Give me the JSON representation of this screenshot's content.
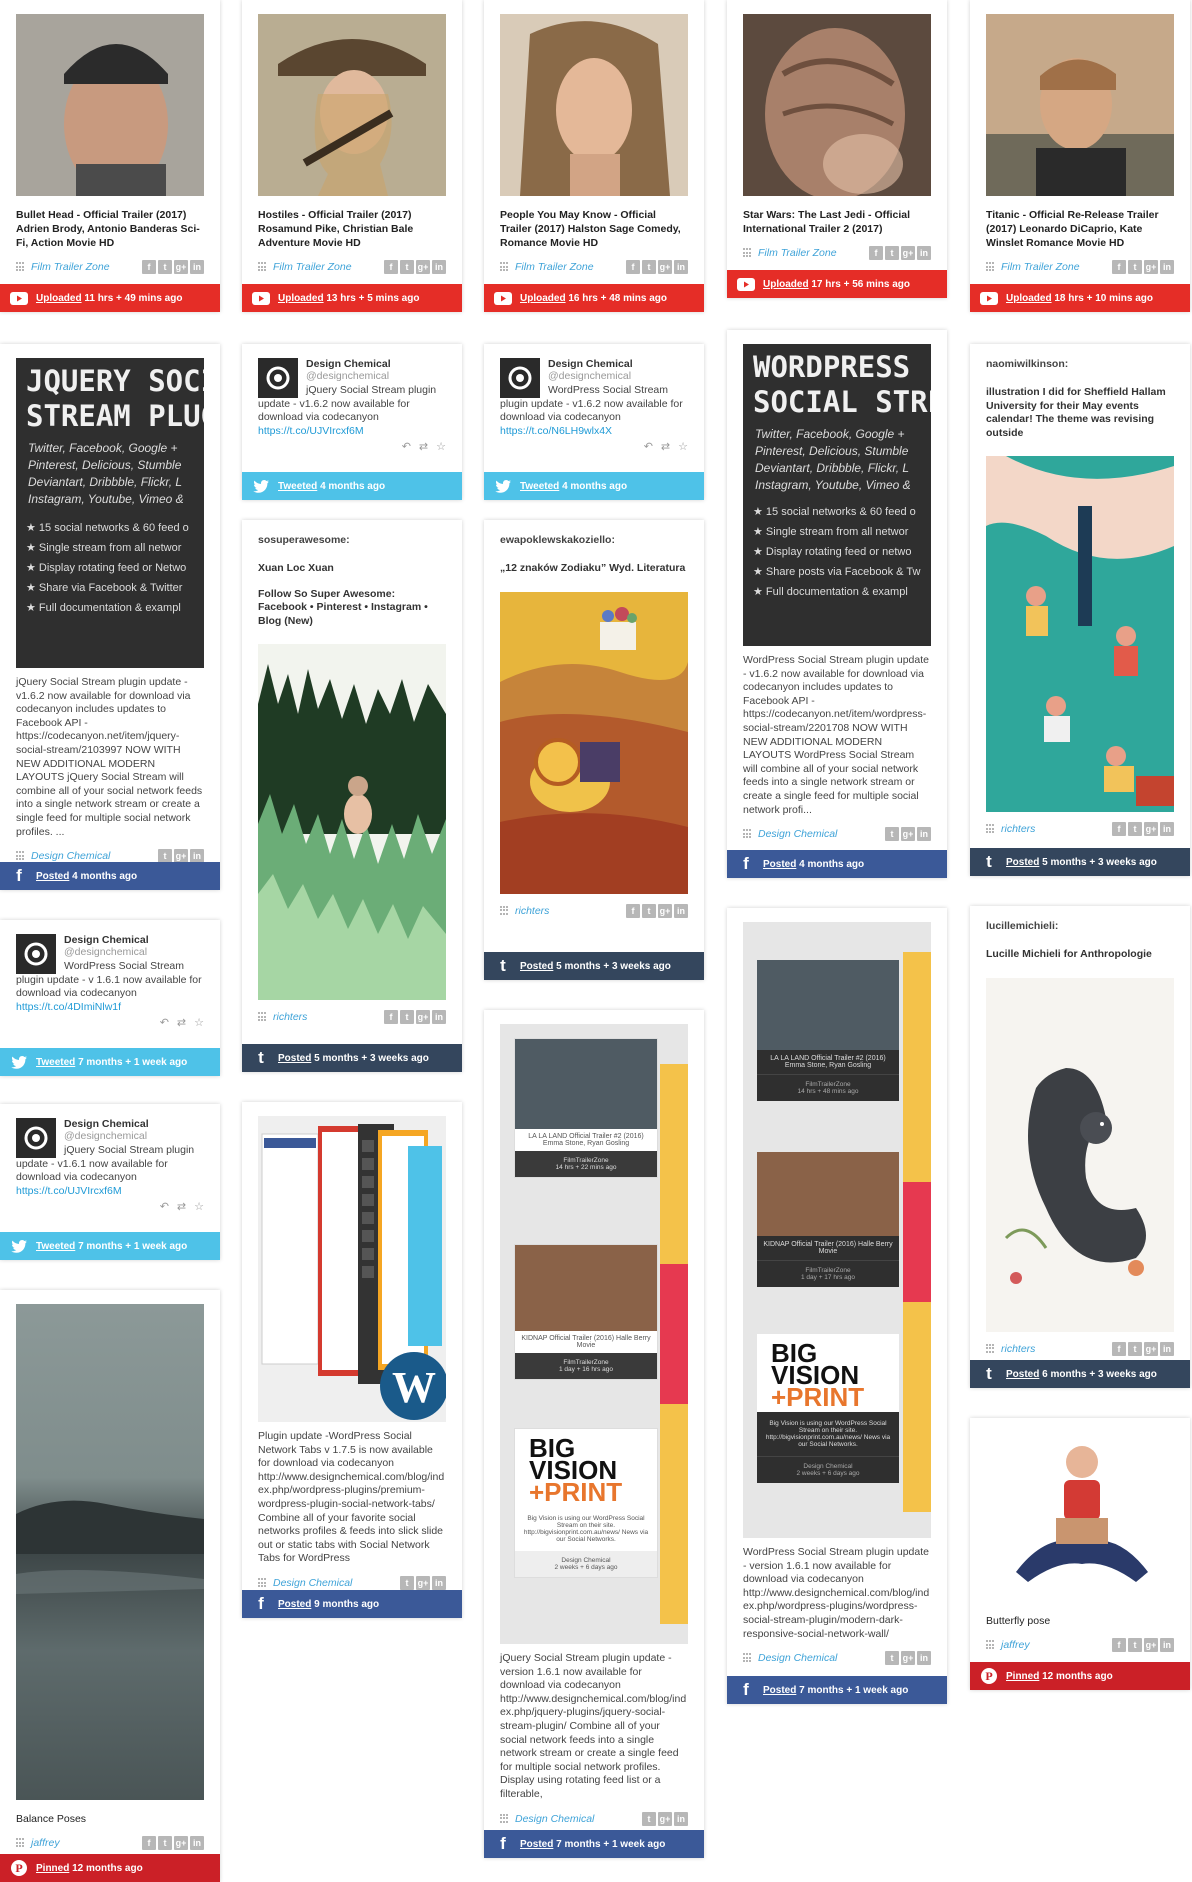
{
  "colors": {
    "youtube": "#e52d27",
    "facebook": "#3b5998",
    "twitter": "#4ec2e8",
    "tumblr": "#34465d",
    "pinterest": "#cb2027",
    "link": "#3fa3d8"
  },
  "share_icons": [
    "f",
    "t",
    "g+",
    "in"
  ],
  "cards": {
    "c1": {
      "title": "Bullet Head - Official Trailer (2017) Adrien Brody, Antonio Banderas Sci-Fi, Action Movie HD",
      "source": "Film Trailer Zone",
      "verb": "Uploaded",
      "time": "11 hrs + 49 mins ago"
    },
    "c2": {
      "title": "Hostiles - Official Trailer (2017) Rosamund Pike, Christian Bale Adventure Movie HD",
      "source": "Film Trailer Zone",
      "verb": "Uploaded",
      "time": "13 hrs + 5 mins ago"
    },
    "c3": {
      "title": "People You May Know - Official Trailer (2017) Halston Sage Comedy, Romance Movie HD",
      "source": "Film Trailer Zone",
      "verb": "Uploaded",
      "time": "16 hrs + 48 mins ago"
    },
    "c4": {
      "title": "Star Wars: The Last Jedi - Official International Trailer 2 (2017)",
      "source": "Film Trailer Zone",
      "verb": "Uploaded",
      "time": "17 hrs + 56 mins ago"
    },
    "c5": {
      "title": "Titanic - Official Re-Release Trailer (2017) Leonardo DiCaprio, Kate Winslet Romance Movie HD",
      "source": "Film Trailer Zone",
      "verb": "Uploaded",
      "time": "18 hrs + 10 mins ago"
    },
    "c6": {
      "img_lines": [
        "JQUERY SOCI",
        "STREAM PLUG"
      ],
      "img_sub": [
        "Twitter, Facebook, Google +",
        "Pinterest, Delicious, Stumble",
        "Deviantart, Dribbble, Flickr, L",
        "Instagram, Youtube, Vimeo &"
      ],
      "img_list": [
        "15 social networks & 60 feed o",
        "Single stream from all networ",
        "Display rotating feed or Netwo",
        "Share via Facebook & Twitter",
        "Full documentation & exampl"
      ],
      "desc": "jQuery Social Stream plugin update - v1.6.2 now available for download via codecanyon includes updates to Facebook API - https://codecanyon.net/item/jquery-social-stream/2103997  NOW WITH NEW ADDITIONAL MODERN LAYOUTS jQuery Social Stream will combine all of your social network feeds into a single network stream or create a single feed for multiple social network profiles. ...",
      "source": "Design Chemical",
      "verb": "Posted",
      "time": "4 months ago"
    },
    "c7": {
      "name": "Design Chemical",
      "handle": "@designchemical",
      "text": "jQuery Social Stream plugin update - v1.6.2 now available for download via codecanyon",
      "link": "https://t.co/UJVIrcxf6M",
      "verb": "Tweeted",
      "time": "4 months ago"
    },
    "c8": {
      "name": "Design Chemical",
      "handle": "@designchemical",
      "text": "WordPress Social Stream plugin update - v1.6.2 now available for download via codecanyon",
      "link": "https://t.co/N6LH9wlx4X",
      "verb": "Tweeted",
      "time": "4 months ago"
    },
    "c9": {
      "img_lines": [
        "WORDPRESS",
        "SOCIAL STREA"
      ],
      "img_sub": [
        "Twitter, Facebook, Google +",
        "Pinterest, Delicious, Stumble",
        "Deviantart, Dribbble, Flickr, L",
        "Instagram, Youtube, Vimeo &"
      ],
      "img_list": [
        "15 social networks & 60 feed o",
        "Single stream from all networ",
        "Display rotating feed or netwo",
        "Share posts via Facebook & Tw",
        "Full documentation & exampl"
      ],
      "desc": "WordPress Social Stream plugin update - v1.6.2 now available for download via codecanyon includes updates to Facebook API - https://codecanyon.net/item/wordpress-social-stream/2201708  NOW WITH NEW ADDITIONAL MODERN LAYOUTS WordPress Social Stream will combine all of your social network feeds into a single network stream or create a single feed for multiple social network profi...",
      "source": "Design Chemical",
      "verb": "Posted",
      "time": "4 months ago"
    },
    "c10": {
      "user": "naomiwilkinson:",
      "text": "illustration I did for Sheffield Hallam University for their May events calendar! The theme was revising outside",
      "source": "richters",
      "verb": "Posted",
      "time": "5 months + 3 weeks ago"
    },
    "c11": {
      "user": "sosuperawesome:",
      "text1": "Xuan Loc Xuan",
      "text2": "Follow So Super Awesome: Facebook • Pinterest • Instagram • Blog (New)",
      "source": "richters",
      "verb": "Posted",
      "time": "5 months + 3 weeks ago"
    },
    "c12": {
      "user": "ewapoklewskakoziello:",
      "text": "„12 znaków Zodiaku” Wyd. Literatura",
      "source": "richters",
      "verb": "Posted",
      "time": "5 months + 3 weeks ago"
    },
    "c13": {
      "name": "Design Chemical",
      "handle": "@designchemical",
      "text": "WordPress Social Stream plugin update - v 1.6.1 now available for download via codecanyon",
      "link": "https://t.co/4DImiNlw1f",
      "verb": "Tweeted",
      "time": "7 months + 1 week ago"
    },
    "c14": {
      "name": "Design Chemical",
      "handle": "@designchemical",
      "text": "jQuery Social Stream plugin update - v1.6.1 now available for download via codecanyon",
      "link": "https://t.co/UJVIrcxf6M",
      "verb": "Tweeted",
      "time": "7 months + 1 week ago"
    },
    "c15": {
      "user": "lucillemichieli:",
      "text": "Lucille Michieli for Anthropologie",
      "source": "richters",
      "verb": "Posted",
      "time": "6 months + 3 weeks ago"
    },
    "c16": {
      "desc": "Plugin update -WordPress Social Network Tabs v 1.7.5 is now available for download via codecanyon http://www.designchemical.com/blog/index.php/wordpress-plugins/premium-wordpress-plugin-social-network-tabs/  Combine all of your favorite social networks profiles & feeds into slick slide out or static tabs with Social Network Tabs for WordPress",
      "source": "Design Chemical",
      "verb": "Posted",
      "time": "9 months ago"
    },
    "c17": {
      "sc1_title": "LA LA LAND Official Trailer #2 (2016) Emma Stone, Ryan Gosling",
      "sc1_src": "FilmTrailerZone",
      "sc1_time": "14 hrs + 22 mins ago",
      "sc2_title": "KIDNAP Official Trailer (2016) Halle Berry Movie",
      "sc2_src": "FilmTrailerZone",
      "sc2_time": "1 day + 16 hrs ago",
      "sc3_logo1": "BIG",
      "sc3_logo2": "VISION",
      "sc3_logo3": "+PRINT",
      "sc3_text": "Big Vision is using our WordPress Social Stream on their site. http://bigvisionprint.com.au/news/ News via our Social Networks.",
      "sc3_src": "Design Chemical",
      "sc3_time": "2 weeks + 6 days ago",
      "desc": "jQuery Social Stream plugin update - version 1.6.1 now available for download via codecanyon http://www.designchemical.com/blog/index.php/jquery-plugins/jquery-social-stream-plugin/  Combine all of your social network feeds into a single network stream or create a single feed for multiple social network profiles. Display using rotating feed list or a filterable,",
      "source": "Design Chemical",
      "verb": "Posted",
      "time": "7 months + 1 week ago"
    },
    "c18": {
      "sc1_title": "LA LA LAND Official Trailer #2 (2016) Emma Stone, Ryan Gosling",
      "sc1_src": "FilmTrailerZone",
      "sc1_time": "14 hrs + 48 mins ago",
      "sc2_title": "KIDNAP Official Trailer (2016) Halle Berry Movie",
      "sc2_src": "FilmTrailerZone",
      "sc2_time": "1 day + 17 hrs ago",
      "sc3_logo1": "BIG",
      "sc3_logo2": "VISION",
      "sc3_logo3": "+PRINT",
      "sc3_text": "Big Vision is using our WordPress Social Stream on their site. http://bigvisionprint.com.au/news/ News via our Social Networks.",
      "sc3_src": "Design Chemical",
      "sc3_time": "2 weeks + 6 days ago",
      "desc": "WordPress Social Stream plugin update - version 1.6.1 now available for download via codecanyon http://www.designchemical.com/blog/index.php/wordpress-plugins/wordpress-social-stream-plugin/modern-dark-responsive-social-network-wall/",
      "source": "Design Chemical",
      "verb": "Posted",
      "time": "7 months + 1 week ago"
    },
    "c19": {
      "title": "Balance Poses",
      "source": "jaffrey",
      "verb": "Pinned",
      "time": "12 months ago"
    },
    "c20": {
      "title": "Butterfly pose",
      "source": "jaffrey",
      "verb": "Pinned",
      "time": "12 months ago"
    }
  }
}
